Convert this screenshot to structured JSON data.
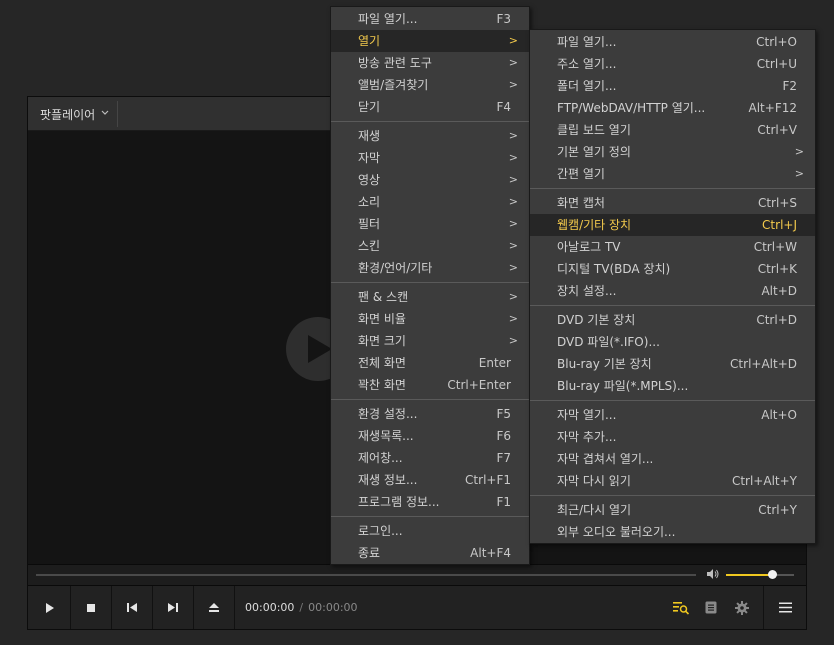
{
  "player": {
    "title": "팟플레이어",
    "time_current": "00:00:00",
    "time_separator": "/",
    "time_total": "00:00:00",
    "volume_level": 0.68,
    "accent_color": "#f0c820"
  },
  "main_menu": [
    {
      "label": "파일 열기...",
      "shortcut": "F3"
    },
    {
      "label": "열기",
      "arrow": ">",
      "highlighted": true
    },
    {
      "label": "방송 관련 도구",
      "arrow": ">"
    },
    {
      "label": "앨범/즐겨찾기",
      "arrow": ">"
    },
    {
      "label": "닫기",
      "shortcut": "F4"
    },
    {
      "separator": true
    },
    {
      "label": "재생",
      "arrow": ">"
    },
    {
      "label": "자막",
      "arrow": ">"
    },
    {
      "label": "영상",
      "arrow": ">"
    },
    {
      "label": "소리",
      "arrow": ">"
    },
    {
      "label": "필터",
      "arrow": ">"
    },
    {
      "label": "스킨",
      "arrow": ">"
    },
    {
      "label": "환경/언어/기타",
      "arrow": ">"
    },
    {
      "separator": true
    },
    {
      "label": "팬 & 스캔",
      "arrow": ">"
    },
    {
      "label": "화면 비율",
      "arrow": ">"
    },
    {
      "label": "화면 크기",
      "arrow": ">"
    },
    {
      "label": "전체 화면",
      "shortcut": "Enter"
    },
    {
      "label": "꽉찬 화면",
      "shortcut": "Ctrl+Enter"
    },
    {
      "separator": true
    },
    {
      "label": "환경 설정...",
      "shortcut": "F5"
    },
    {
      "label": "재생목록...",
      "shortcut": "F6"
    },
    {
      "label": "제어창...",
      "shortcut": "F7"
    },
    {
      "label": "재생 정보...",
      "shortcut": "Ctrl+F1"
    },
    {
      "label": "프로그램 정보...",
      "shortcut": "F1"
    },
    {
      "separator": true
    },
    {
      "label": "로그인..."
    },
    {
      "label": "종료",
      "shortcut": "Alt+F4"
    }
  ],
  "sub_menu": [
    {
      "label": "파일 열기...",
      "shortcut": "Ctrl+O"
    },
    {
      "label": "주소 열기...",
      "shortcut": "Ctrl+U"
    },
    {
      "label": "폴더 열기...",
      "shortcut": "F2"
    },
    {
      "label": "FTP/WebDAV/HTTP 열기...",
      "shortcut": "Alt+F12"
    },
    {
      "label": "클립 보드 열기",
      "shortcut": "Ctrl+V"
    },
    {
      "label": "기본 열기 정의",
      "arrow": ">"
    },
    {
      "label": "간편 열기",
      "arrow": ">"
    },
    {
      "separator": true
    },
    {
      "label": "화면 캡처",
      "shortcut": "Ctrl+S"
    },
    {
      "label": "웹캠/기타 장치",
      "shortcut": "Ctrl+J",
      "highlighted": true
    },
    {
      "label": "아날로그 TV",
      "shortcut": "Ctrl+W"
    },
    {
      "label": "디지털 TV(BDA 장치)",
      "shortcut": "Ctrl+K"
    },
    {
      "label": "장치 설정...",
      "shortcut": "Alt+D"
    },
    {
      "separator": true
    },
    {
      "label": "DVD 기본 장치",
      "shortcut": "Ctrl+D"
    },
    {
      "label": "DVD 파일(*.IFO)..."
    },
    {
      "label": "Blu-ray 기본 장치",
      "shortcut": "Ctrl+Alt+D"
    },
    {
      "label": "Blu-ray 파일(*.MPLS)..."
    },
    {
      "separator": true
    },
    {
      "label": "자막 열기...",
      "shortcut": "Alt+O"
    },
    {
      "label": "자막 추가..."
    },
    {
      "label": "자막 겹쳐서 열기..."
    },
    {
      "label": "자막 다시 읽기",
      "shortcut": "Ctrl+Alt+Y"
    },
    {
      "separator": true
    },
    {
      "label": "최근/다시 열기",
      "shortcut": "Ctrl+Y"
    },
    {
      "label": "외부 오디오 불러오기..."
    }
  ],
  "icons": {
    "play": "play-icon",
    "stop": "stop-icon",
    "prev": "skip-back-icon",
    "next": "skip-forward-icon",
    "eject": "eject-icon",
    "playlist": "playlist-search-icon",
    "chapter": "document-icon",
    "settings": "gear-icon",
    "menu": "hamburger-menu-icon",
    "volume": "speaker-icon"
  }
}
